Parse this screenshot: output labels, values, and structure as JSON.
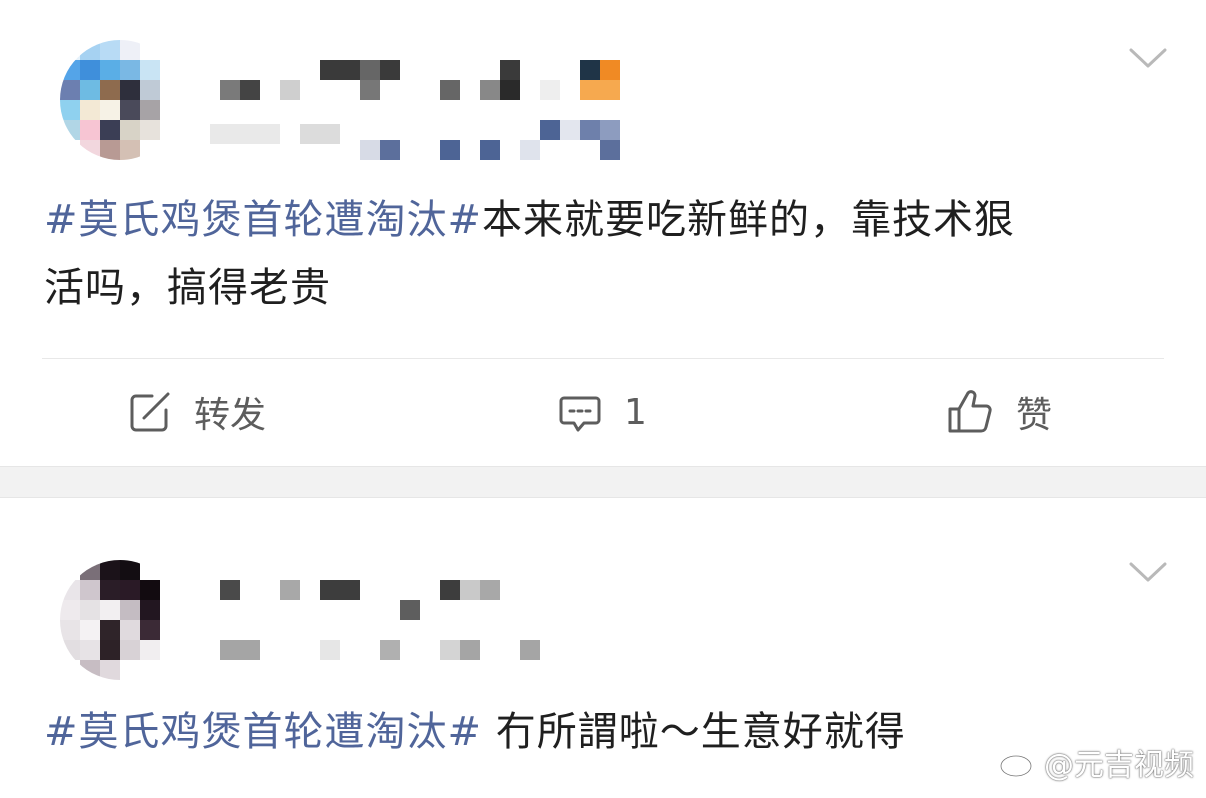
{
  "posts": [
    {
      "hashtag": "#莫氏鸡煲首轮遭淘汰#",
      "text_line1": "本来就要吃新鲜的，靠技术狠",
      "text_line2": "活吗，搞得老贵",
      "actions": {
        "repost_label": "转发",
        "comment_count": "1",
        "like_label": "赞"
      }
    },
    {
      "hashtag": "#莫氏鸡煲首轮遭淘汰#",
      "text": " 冇所謂啦～生意好就得"
    }
  ],
  "watermark": {
    "text": "@元吉视频",
    "icon": "weibo-icon"
  },
  "colors": {
    "hashtag": "#50659a",
    "text": "#1f1f1f",
    "action": "#5d5d5d",
    "separator": "#f2f2f2"
  }
}
